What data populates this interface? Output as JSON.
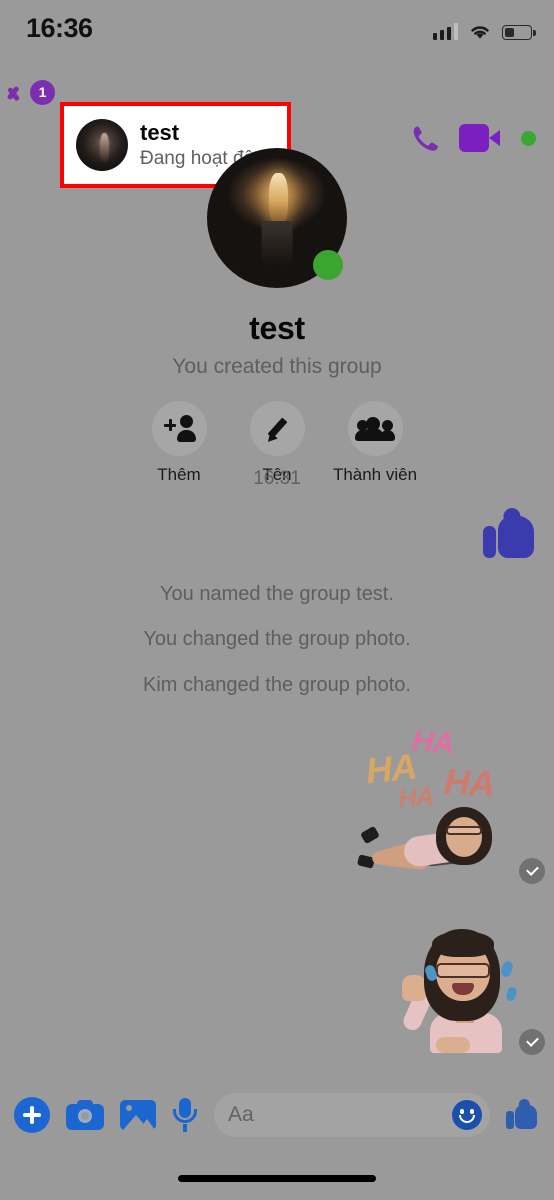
{
  "status_bar": {
    "time": "16:36",
    "signal_icon": "cellular-signal-icon",
    "wifi_icon": "wifi-icon",
    "battery_icon": "battery-icon",
    "battery_level_percent": 35
  },
  "chat_header": {
    "back_icon": "back-chevron-icon",
    "unread_badge": "1",
    "highlighted": true,
    "highlight_color": "#ff0000",
    "avatar_icon": "contact-avatar",
    "name": "test",
    "status": "Đang hoạt động",
    "call_icon": "phone-call-icon",
    "video_icon": "video-call-icon",
    "online_indicator": "online-dot-icon",
    "accent_color": "#7b2fb0"
  },
  "group_intro": {
    "avatar_icon": "group-avatar",
    "online_indicator": "online-dot-icon",
    "name": "test",
    "subtitle": "You created this group",
    "actions": [
      {
        "label": "Thêm",
        "icon": "add-person-icon"
      },
      {
        "label": "Tên",
        "icon": "pencil-edit-icon"
      },
      {
        "label": "Thành viên",
        "icon": "members-people-icon"
      }
    ]
  },
  "conversation": {
    "timestamp": "16:31",
    "system_messages": [
      "You named the group test.",
      "You changed the group photo.",
      "Kim changed the group photo."
    ],
    "stickers": [
      {
        "name": "thumbs-up-sticker",
        "alt": "Thumbs up",
        "color": "#3b3bae",
        "delivered": false
      },
      {
        "name": "haha-laughing-sticker",
        "alt": "HA HA HA HA laughing avatar",
        "delivered": true
      },
      {
        "name": "waving-avatar-sticker",
        "alt": "Waving avatar",
        "delivered": true
      }
    ],
    "haha_words": [
      "HA",
      "HA",
      "HA",
      "HA"
    ],
    "delivered_icon": "delivered-check-icon"
  },
  "composer": {
    "buttons": [
      {
        "name": "add-attachment-button",
        "icon": "plus-circle-icon"
      },
      {
        "name": "camera-button",
        "icon": "camera-icon"
      },
      {
        "name": "gallery-button",
        "icon": "image-icon"
      },
      {
        "name": "voice-button",
        "icon": "microphone-icon"
      }
    ],
    "input_placeholder": "Aa",
    "input_value": "",
    "emoji_icon": "smiley-emoji-icon",
    "like_icon": "thumbs-up-icon",
    "accent_color": "#1b66d0"
  },
  "system": {
    "home_indicator": "home-indicator-bar"
  }
}
